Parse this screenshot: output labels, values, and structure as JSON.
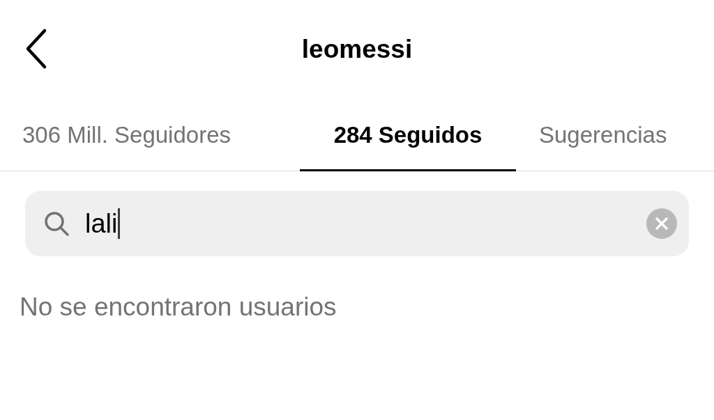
{
  "header": {
    "title": "leomessi"
  },
  "tabs": [
    {
      "label": "306 Mill. Seguidores",
      "selected": false
    },
    {
      "label": "284 Seguidos",
      "selected": true
    },
    {
      "label": "Sugerencias",
      "selected": false
    }
  ],
  "search": {
    "value": "lali",
    "focused": true
  },
  "message": "No se encontraron usuarios"
}
